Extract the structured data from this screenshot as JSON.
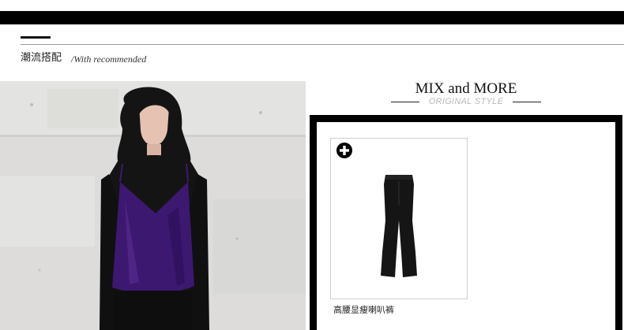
{
  "section": {
    "title": "潮流搭配",
    "subtitle": "/With recommended"
  },
  "mix": {
    "title": "MIX and MORE",
    "subtitle": "ORIGINAL STYLE"
  },
  "product": {
    "name": "高腰显瘦喇叭裤",
    "add_icon": "plus-circle-icon"
  },
  "colors": {
    "bar": "#000000",
    "subtitle_gray": "#b8b8b8",
    "top_purple": "#3d1870"
  }
}
